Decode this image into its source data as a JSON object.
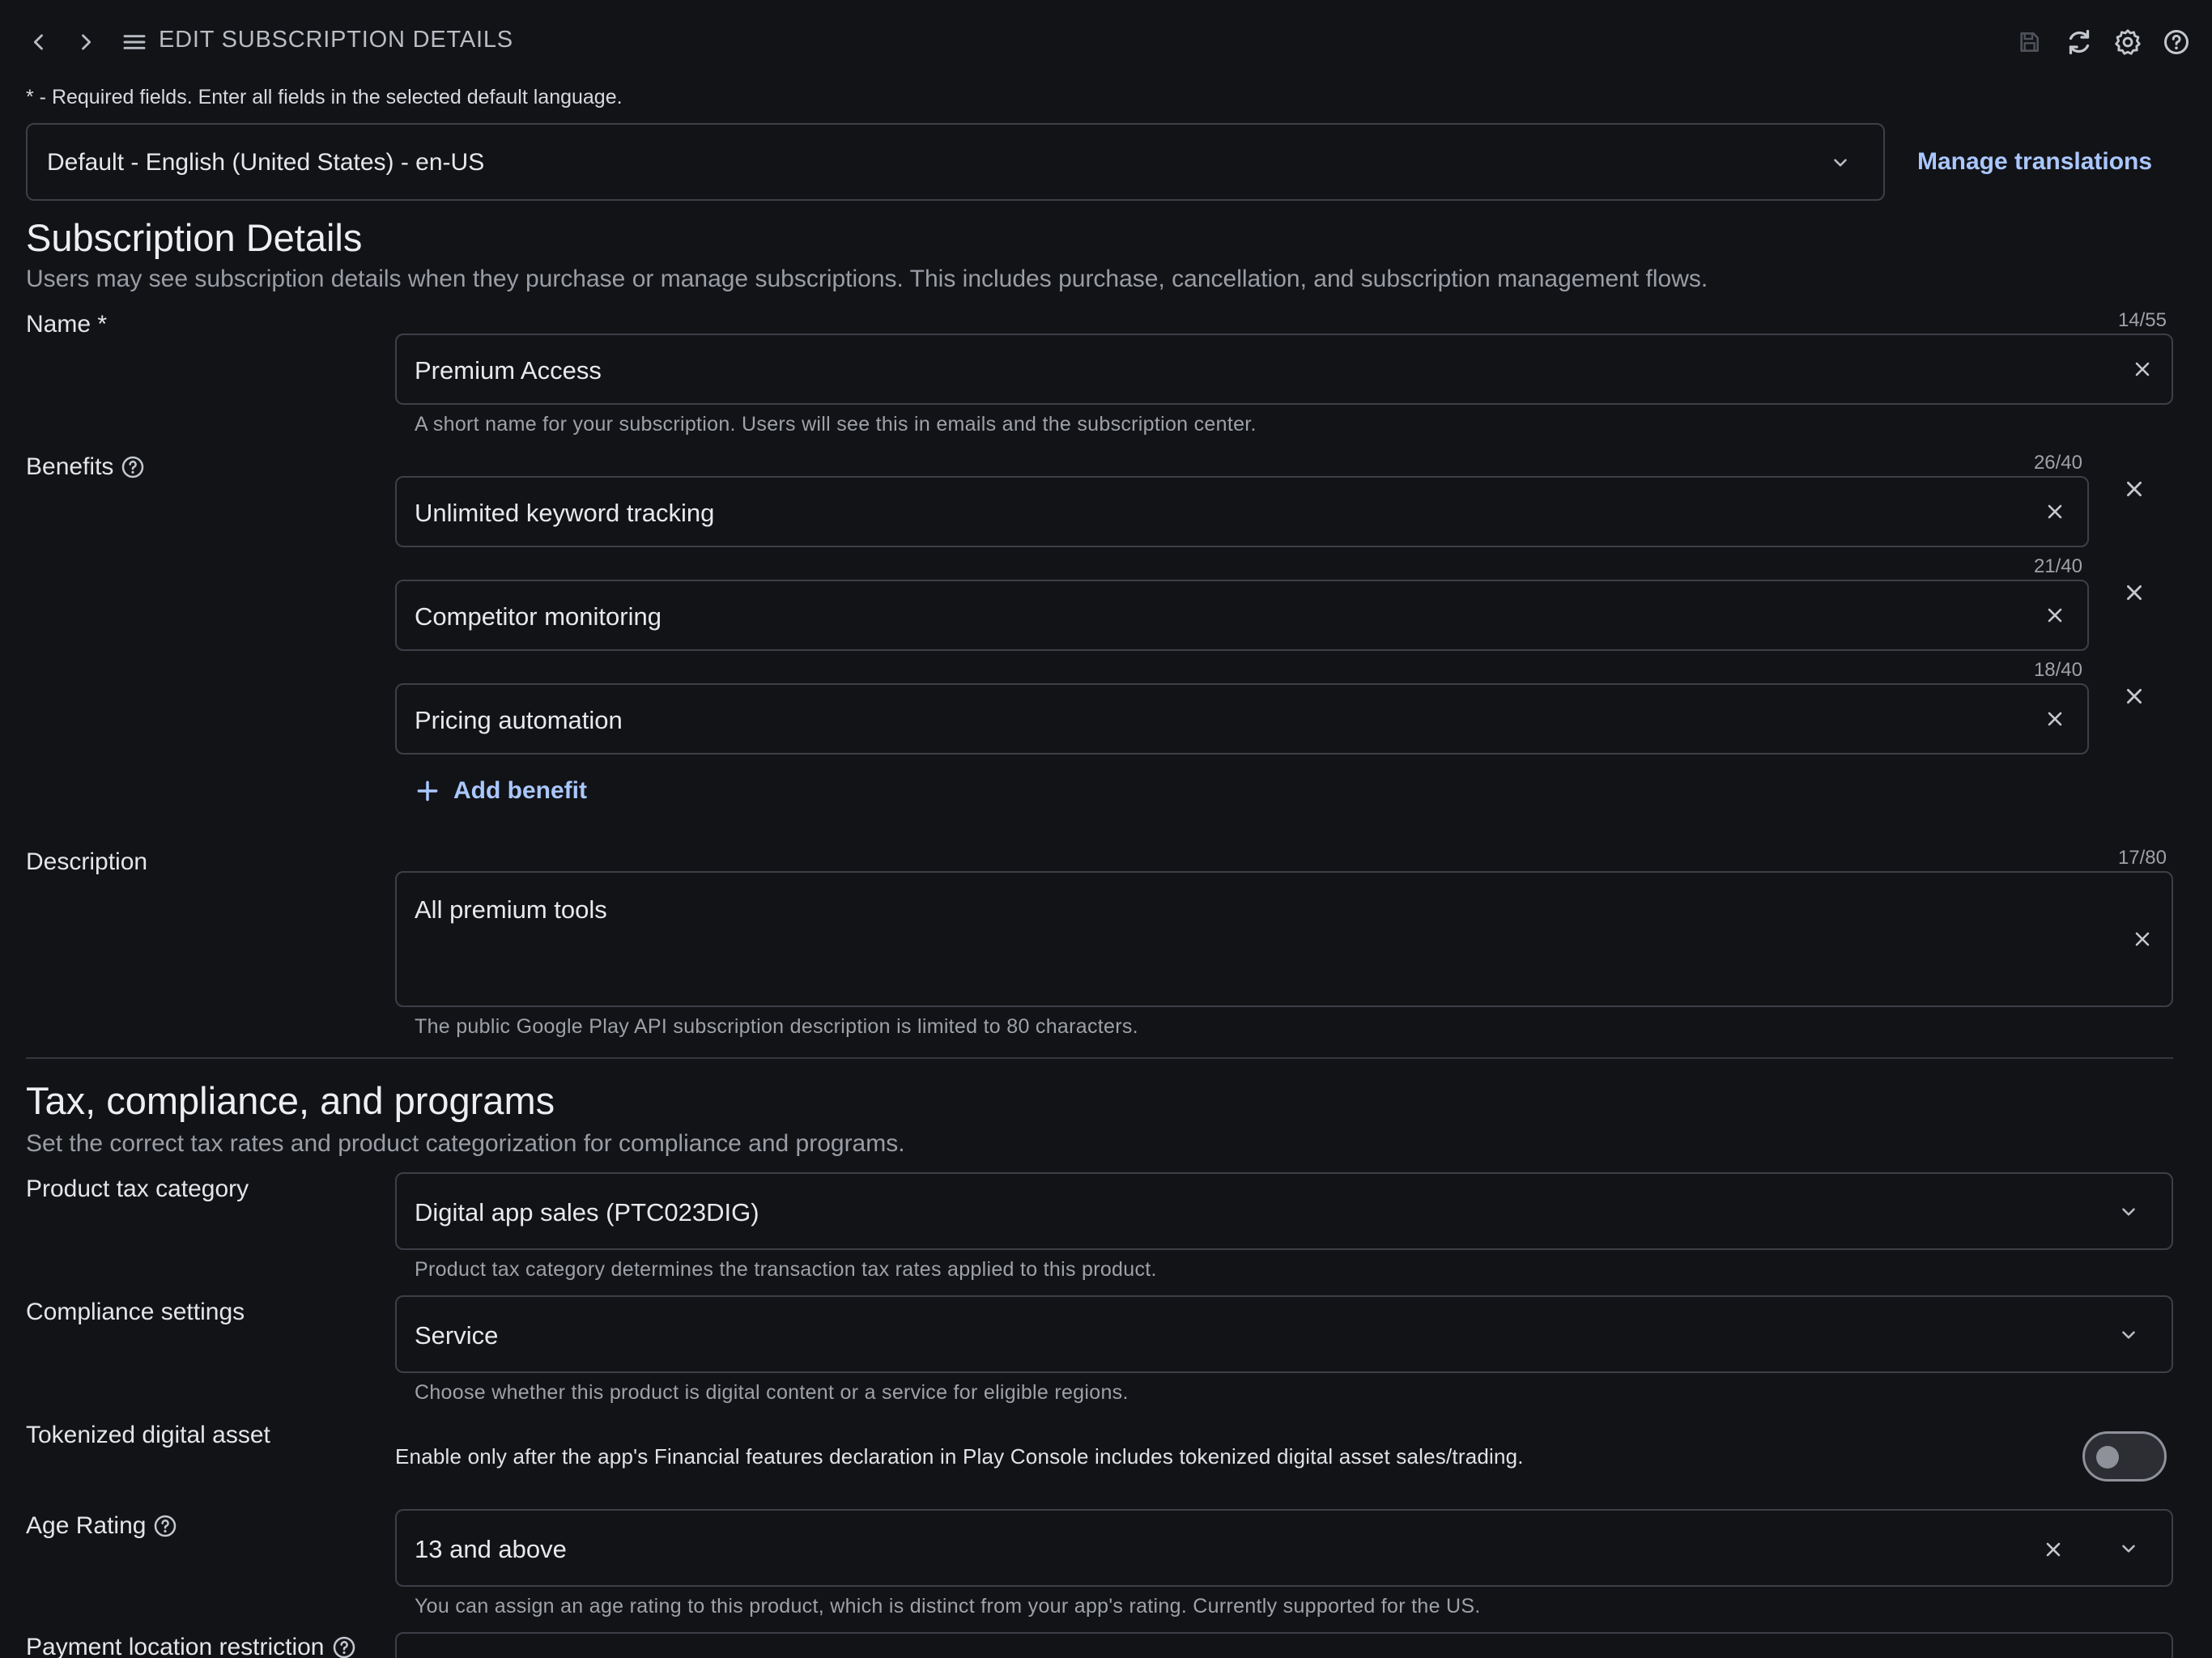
{
  "header": {
    "title": "EDIT SUBSCRIPTION DETAILS"
  },
  "required_note": "* - Required fields. Enter all fields in the selected default language.",
  "language": {
    "selected": "Default - English (United States) - en-US",
    "manage_translations": "Manage translations"
  },
  "subscription_details": {
    "title": "Subscription Details",
    "subtitle": "Users may see subscription details when they purchase or manage subscriptions. This includes purchase, cancellation, and subscription management flows.",
    "name": {
      "label": "Name *",
      "value": "Premium Access",
      "counter": "14/55",
      "helper": "A short name for your subscription. Users will see this in emails and the subscription center."
    },
    "benefits": {
      "label": "Benefits",
      "items": [
        {
          "value": "Unlimited keyword tracking",
          "counter": "26/40"
        },
        {
          "value": "Competitor monitoring",
          "counter": "21/40"
        },
        {
          "value": "Pricing automation",
          "counter": "18/40"
        }
      ],
      "add_label": "Add benefit"
    },
    "description": {
      "label": "Description",
      "value": "All premium tools",
      "counter": "17/80",
      "helper": "The public Google Play API subscription description is limited to 80 characters."
    }
  },
  "tax": {
    "title": "Tax, compliance, and programs",
    "subtitle": "Set the correct tax rates and product categorization for compliance and programs.",
    "product_tax_category": {
      "label": "Product tax category",
      "value": "Digital app sales (PTC023DIG)",
      "helper": "Product tax category determines the transaction tax rates applied to this product."
    },
    "compliance_settings": {
      "label": "Compliance settings",
      "value": "Service",
      "helper": "Choose whether this product is digital content or a service for eligible regions."
    },
    "tokenized_digital_asset": {
      "label": "Tokenized digital asset",
      "description": "Enable only after the app's Financial features declaration in Play Console includes tokenized digital asset sales/trading.",
      "enabled": false
    },
    "age_rating": {
      "label": "Age Rating",
      "value": "13 and above",
      "helper": "You can assign an age rating to this product, which is distinct from your app's rating. Currently supported for the US."
    },
    "payment_location_restriction": {
      "label": "Payment location restriction"
    }
  },
  "colors": {
    "background": "#121317",
    "accent": "#aac7ff",
    "border": "#3c3f46",
    "muted_text": "#9ea1a8"
  }
}
